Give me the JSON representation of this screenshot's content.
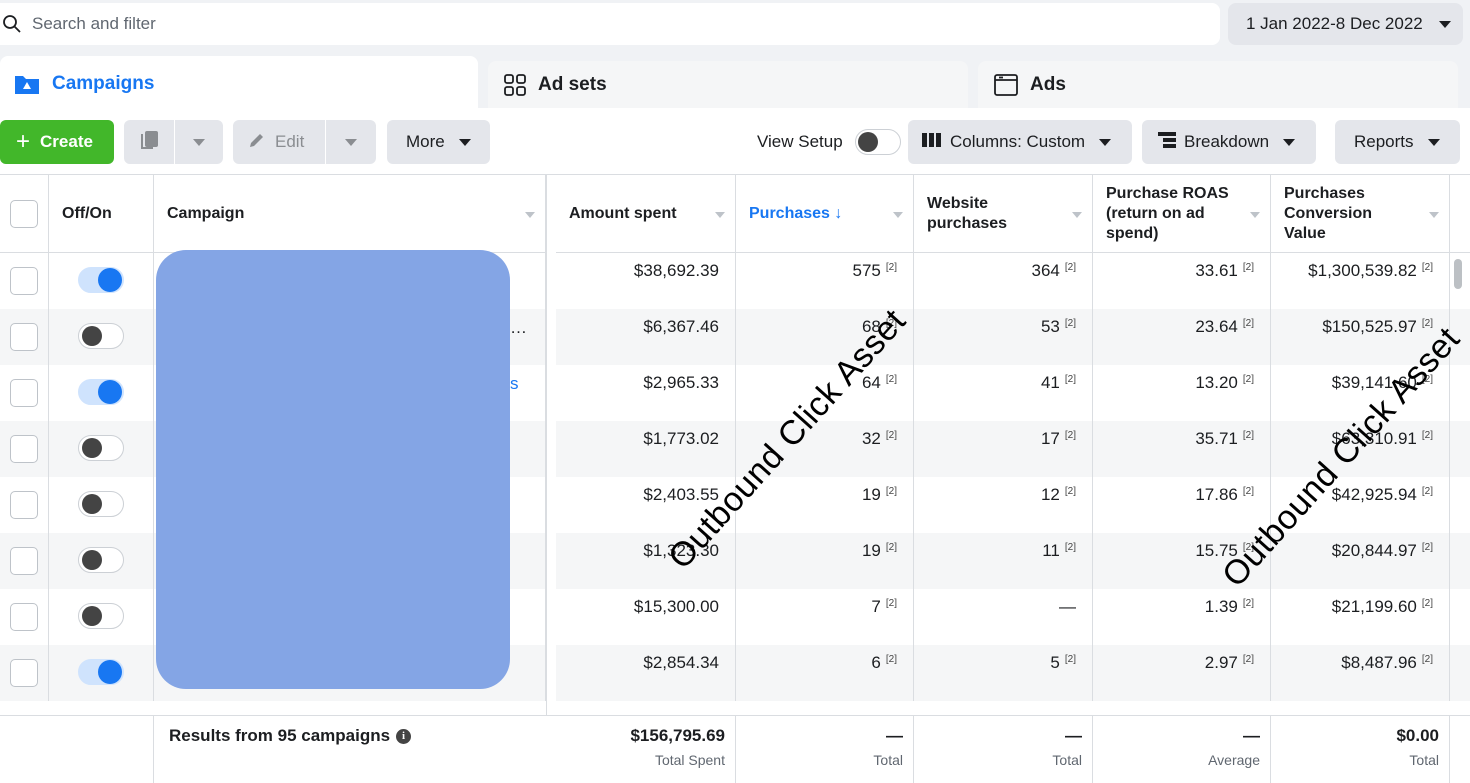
{
  "search": {
    "placeholder": "Search and filter"
  },
  "date_range": {
    "label": "1 Jan 2022-8 Dec 2022"
  },
  "tabs": [
    {
      "label": "Campaigns",
      "icon": "folder-icon",
      "active": true
    },
    {
      "label": "Ad sets",
      "icon": "grid-icon",
      "active": false
    },
    {
      "label": "Ads",
      "icon": "ad-window-icon",
      "active": false
    }
  ],
  "toolbar": {
    "create_label": "Create",
    "edit_label": "Edit",
    "more_label": "More",
    "view_setup_label": "View Setup",
    "columns_label": "Columns: Custom",
    "breakdown_label": "Breakdown",
    "reports_label": "Reports"
  },
  "columns": {
    "offon": "Off/On",
    "campaign": "Campaign",
    "amount_spent": "Amount spent",
    "purchases": "Purchases ↓",
    "website_purchases_1": "Website",
    "website_purchases_2": "purchases",
    "roas_1": "Purchase ROAS",
    "roas_2": "(return on ad",
    "roas_3": "spend)",
    "conv_1": "Purchases",
    "conv_2": "Conversion",
    "conv_3": "Value"
  },
  "rows": [
    {
      "on": true,
      "amount": "$38,692.39",
      "purchases": "575",
      "website": "364",
      "roas": "33.61",
      "value": "$1,300,539.82"
    },
    {
      "on": false,
      "amount": "$6,367.46",
      "purchases": "68",
      "website": "53",
      "roas": "23.64",
      "value": "$150,525.97"
    },
    {
      "on": true,
      "amount": "$2,965.33",
      "purchases": "64",
      "website": "41",
      "roas": "13.20",
      "value": "$39,141.60"
    },
    {
      "on": false,
      "amount": "$1,773.02",
      "purchases": "32",
      "website": "17",
      "roas": "35.71",
      "value": "$63,310.91"
    },
    {
      "on": false,
      "amount": "$2,403.55",
      "purchases": "19",
      "website": "12",
      "roas": "17.86",
      "value": "$42,925.94"
    },
    {
      "on": false,
      "amount": "$1,323.30",
      "purchases": "19",
      "website": "11",
      "roas": "15.75",
      "value": "$20,844.97"
    },
    {
      "on": false,
      "amount": "$15,300.00",
      "purchases": "7",
      "website": "—",
      "roas": "1.39",
      "value": "$21,199.60"
    },
    {
      "on": true,
      "amount": "$2,854.34",
      "purchases": "6",
      "website": "5",
      "roas": "2.97",
      "value": "$8,487.96"
    }
  ],
  "attribution_marker": "[2]",
  "campaign_fragments": {
    "ellipsis": "…",
    "link_end": "s"
  },
  "footer": {
    "results": "Results from 95 campaigns",
    "total_spent_value": "$156,795.69",
    "total_spent_label": "Total Spent",
    "purchases_value": "—",
    "purchases_label": "Total",
    "website_value": "—",
    "website_label": "Total",
    "roas_value": "—",
    "roas_label": "Average",
    "conv_value": "$0.00",
    "conv_label": "Total"
  },
  "watermark": "Outbound Click Asset",
  "colors": {
    "accent": "#1877f2",
    "create": "#42b72a",
    "redaction": "#84a5e5"
  }
}
